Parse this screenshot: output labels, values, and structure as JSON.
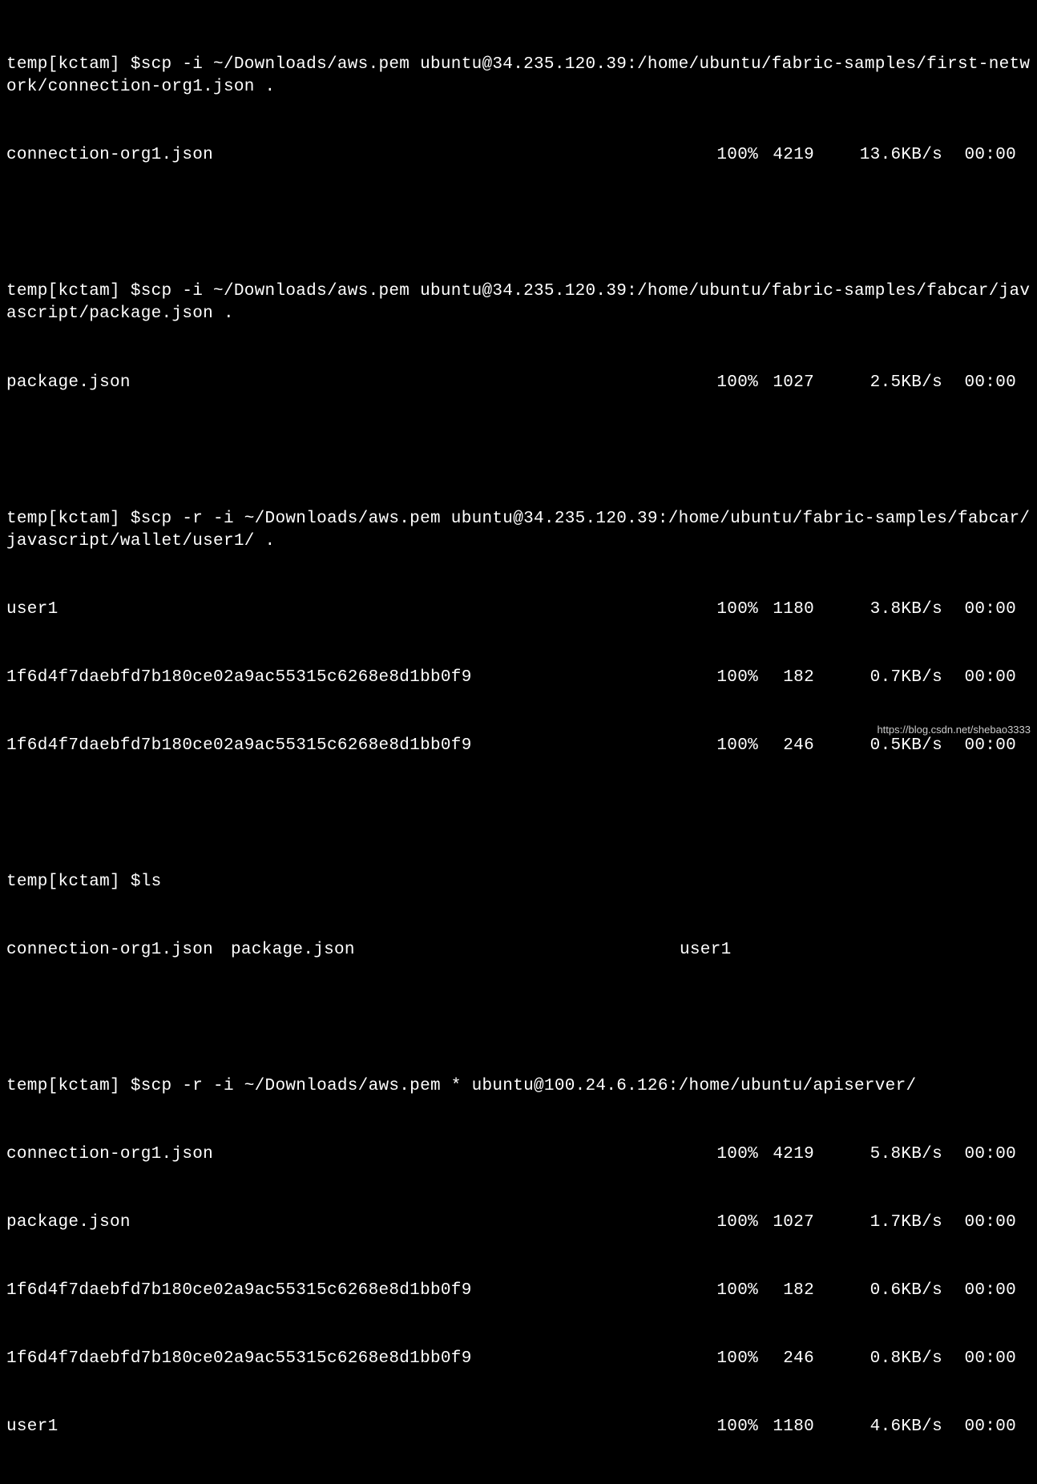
{
  "prompt": "temp[kctam] $",
  "cmd1": "scp -i ~/Downloads/aws.pem ubuntu@34.235.120.39:/home/ubuntu/fabric-samples/first-network/connection-org1.json .",
  "transfer1": {
    "name": "connection-org1.json",
    "pct": "100%",
    "size": "4219",
    "speed": "13.6KB/s",
    "time": "00:00"
  },
  "cmd2": "scp -i ~/Downloads/aws.pem ubuntu@34.235.120.39:/home/ubuntu/fabric-samples/fabcar/javascript/package.json .",
  "transfer2": {
    "name": "package.json",
    "pct": "100%",
    "size": "1027",
    "speed": "2.5KB/s",
    "time": "00:00"
  },
  "cmd3": "scp -r -i ~/Downloads/aws.pem ubuntu@34.235.120.39:/home/ubuntu/fabric-samples/fabcar/javascript/wallet/user1/ .",
  "transfer3a": {
    "name": "user1",
    "pct": "100%",
    "size": "1180",
    "speed": "3.8KB/s",
    "time": "00:00"
  },
  "transfer3b": {
    "name": "1f6d4f7daebfd7b180ce02a9ac55315c6268e8d1bb0f9",
    "pct": "100%",
    "size": "182",
    "speed": "0.7KB/s",
    "time": "00:00"
  },
  "transfer3c": {
    "name": "1f6d4f7daebfd7b180ce02a9ac55315c6268e8d1bb0f9",
    "pct": "100%",
    "size": "246",
    "speed": "0.5KB/s",
    "time": "00:00"
  },
  "cmd4": "ls",
  "ls_items": {
    "a": "connection-org1.json",
    "b": "package.json",
    "c": "user1"
  },
  "cmd5": "scp -r -i ~/Downloads/aws.pem * ubuntu@100.24.6.126:/home/ubuntu/apiserver/",
  "transfer5a": {
    "name": "connection-org1.json",
    "pct": "100%",
    "size": "4219",
    "speed": "5.8KB/s",
    "time": "00:00"
  },
  "transfer5b": {
    "name": "package.json",
    "pct": "100%",
    "size": "1027",
    "speed": "1.7KB/s",
    "time": "00:00"
  },
  "transfer5c": {
    "name": "1f6d4f7daebfd7b180ce02a9ac55315c6268e8d1bb0f9",
    "pct": "100%",
    "size": "182",
    "speed": "0.6KB/s",
    "time": "00:00"
  },
  "transfer5d": {
    "name": "1f6d4f7daebfd7b180ce02a9ac55315c6268e8d1bb0f9",
    "pct": "100%",
    "size": "246",
    "speed": "0.8KB/s",
    "time": "00:00"
  },
  "transfer5e": {
    "name": "user1",
    "pct": "100%",
    "size": "1180",
    "speed": "4.6KB/s",
    "time": "00:00"
  },
  "watermark": "https://blog.csdn.net/shebao3333"
}
